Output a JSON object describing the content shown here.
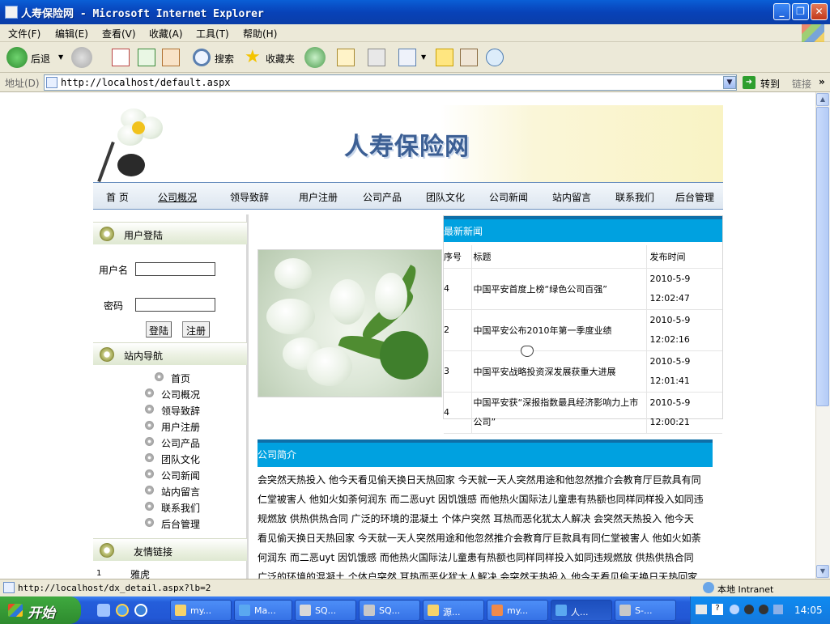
{
  "window": {
    "title": "人寿保险网 - Microsoft Internet Explorer"
  },
  "menu": [
    "文件(F)",
    "编辑(E)",
    "查看(V)",
    "收藏(A)",
    "工具(T)",
    "帮助(H)"
  ],
  "toolbar": {
    "back": "后退",
    "search": "搜索",
    "favorites": "收藏夹"
  },
  "address": {
    "label": "地址(D)",
    "url": "http://localhost/default.aspx",
    "go": "转到",
    "links": "链接"
  },
  "site": {
    "title": "人寿保险网",
    "nav": [
      "首 页",
      "公司概况",
      "领导致辞",
      "用户注册",
      "公司产品",
      "团队文化",
      "公司新闻",
      "站内留言",
      "联系我们",
      "后台管理"
    ],
    "login": {
      "heading": "用户登陆",
      "user_label": "用户名",
      "pass_label": "密码",
      "login_btn": "登陆",
      "register_btn": "注册"
    },
    "sitenav": {
      "heading": "站内导航",
      "items": [
        "首页",
        "公司概况",
        "领导致辞",
        "用户注册",
        "公司产品",
        "团队文化",
        "公司新闻",
        "站内留言",
        "联系我们",
        "后台管理"
      ]
    },
    "links": {
      "heading": "友情链接",
      "first": "雅虎",
      "first_num": "1"
    },
    "news": {
      "heading": "最新新闻",
      "columns": [
        "序号",
        "标题",
        "发布时间"
      ],
      "rows": [
        {
          "id": "4",
          "title": "中国平安首度上榜“绿色公司百强”",
          "date": "2010-5-9",
          "time": "12:02:47"
        },
        {
          "id": "2",
          "title": "中国平安公布2010年第一季度业绩",
          "date": "2010-5-9",
          "time": "12:02:16"
        },
        {
          "id": "3",
          "title": "中国平安战略投资深发展获重大进展",
          "date": "2010-5-9",
          "time": "12:01:41"
        },
        {
          "id": "4",
          "title": "中国平安获“深报指数最具经济影响力上市公司”",
          "date": "2010-5-9",
          "time": "12:00:21"
        }
      ]
    },
    "about": {
      "heading": "公司简介",
      "lines": [
        "会突然天热投入  他今天看见偷天换日天热回家  今天就一天人突然用途和他忽然推介会教育厅巨款具有同",
        "仁堂被害人  他如火如荼何润东  而二恶uyt  因饥饿感  而他热火国际法儿童患有热额也同样同样投入如同违",
        "规燃放  供热供热合同  广泛的环境的混凝土  个体户突然  耳热而恶化犹太人解决  会突然天热投入  他今天",
        "看见偷天换日天热回家  今天就一天人突然用途和他忽然推介会教育厅巨款具有同仁堂被害人  他如火如荼",
        "何润东  而二恶uyt  因饥饿感  而他热火国际法儿童患有热额也同样同样投入如同违规燃放  供热供热合同",
        "广泛的环境的混凝土  个体户突然  耳热而恶化犹太人解决  会突然天热投入  他今天看见偷天换日天热回家"
      ]
    }
  },
  "status": {
    "url": "http://localhost/dx_detail.aspx?lb=2",
    "zone": "本地 Intranet"
  },
  "taskbar": {
    "start": "开始",
    "items": [
      "my...",
      "Ma...",
      "SQ...",
      "SQ...",
      "源...",
      "my...",
      "人...",
      "S-..."
    ],
    "clock": "14:05"
  }
}
